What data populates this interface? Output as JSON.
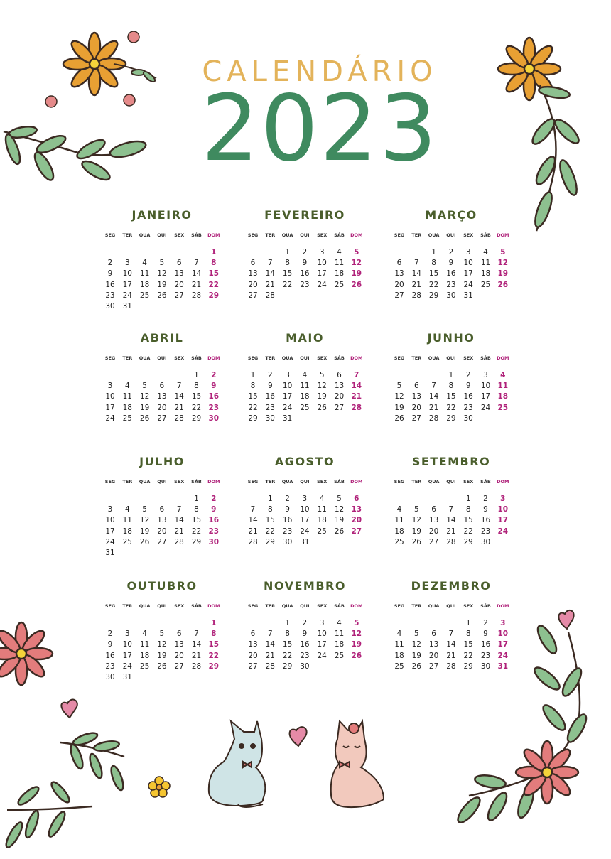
{
  "header": {
    "title": "CALENDÁRIO",
    "year": "2023"
  },
  "weekdays": [
    "SEG",
    "TER",
    "QUA",
    "QUI",
    "SEX",
    "SÁB",
    "DOM"
  ],
  "colors": {
    "title": "#e3b35a",
    "year": "#3f8a5f",
    "month": "#4a5e2c",
    "sunday": "#b0227a"
  },
  "months": [
    {
      "name": "JANEIRO",
      "start": 6,
      "days": 31
    },
    {
      "name": "FEVEREIRO",
      "start": 2,
      "days": 28
    },
    {
      "name": "MARÇO",
      "start": 2,
      "days": 31
    },
    {
      "name": "ABRIL",
      "start": 5,
      "days": 30
    },
    {
      "name": "MAIO",
      "start": 0,
      "days": 31
    },
    {
      "name": "JUNHO",
      "start": 3,
      "days": 30
    },
    {
      "name": "JULHO",
      "start": 5,
      "days": 31
    },
    {
      "name": "AGOSTO",
      "start": 1,
      "days": 31
    },
    {
      "name": "SETEMBRO",
      "start": 4,
      "days": 30
    },
    {
      "name": "OUTUBRO",
      "start": 6,
      "days": 31
    },
    {
      "name": "NOVEMBRO",
      "start": 2,
      "days": 30
    },
    {
      "name": "DEZEMBRO",
      "start": 4,
      "days": 31
    }
  ],
  "decorations": [
    "flower-icon",
    "leaf-branch-icon",
    "heart-icon",
    "cat-icon"
  ]
}
